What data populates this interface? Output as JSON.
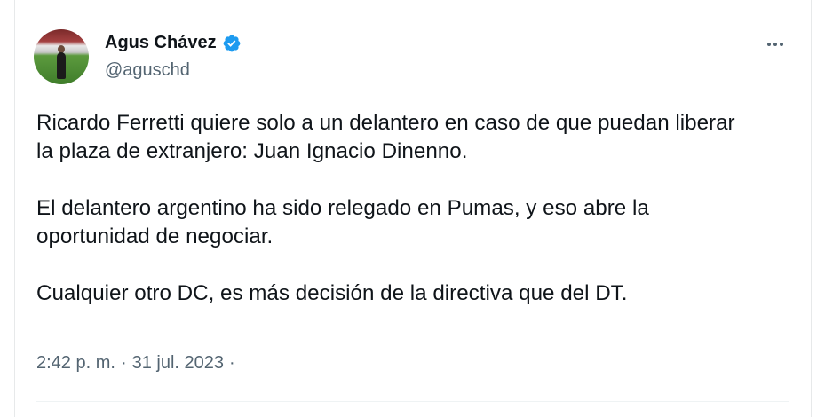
{
  "tweet": {
    "author": {
      "display_name": "Agus Chávez",
      "handle": "@aguschd",
      "verified_color": "#1d9bf0"
    },
    "text_lines": [
      "Ricardo Ferretti quiere solo a un delantero en caso de que puedan liberar",
      "la plaza de extranjero: Juan Ignacio Dinenno.",
      "El delantero argentino ha sido relegado en Pumas, y eso abre la",
      "oportunidad de negociar.",
      "Cualquier otro DC, es más decisión de la directiva que del DT."
    ],
    "meta": {
      "time": "2:42 p. m.",
      "separator": "·",
      "date": "31 jul. 2023",
      "trailing": "·"
    },
    "more_icon": "more-horizontal-icon"
  }
}
